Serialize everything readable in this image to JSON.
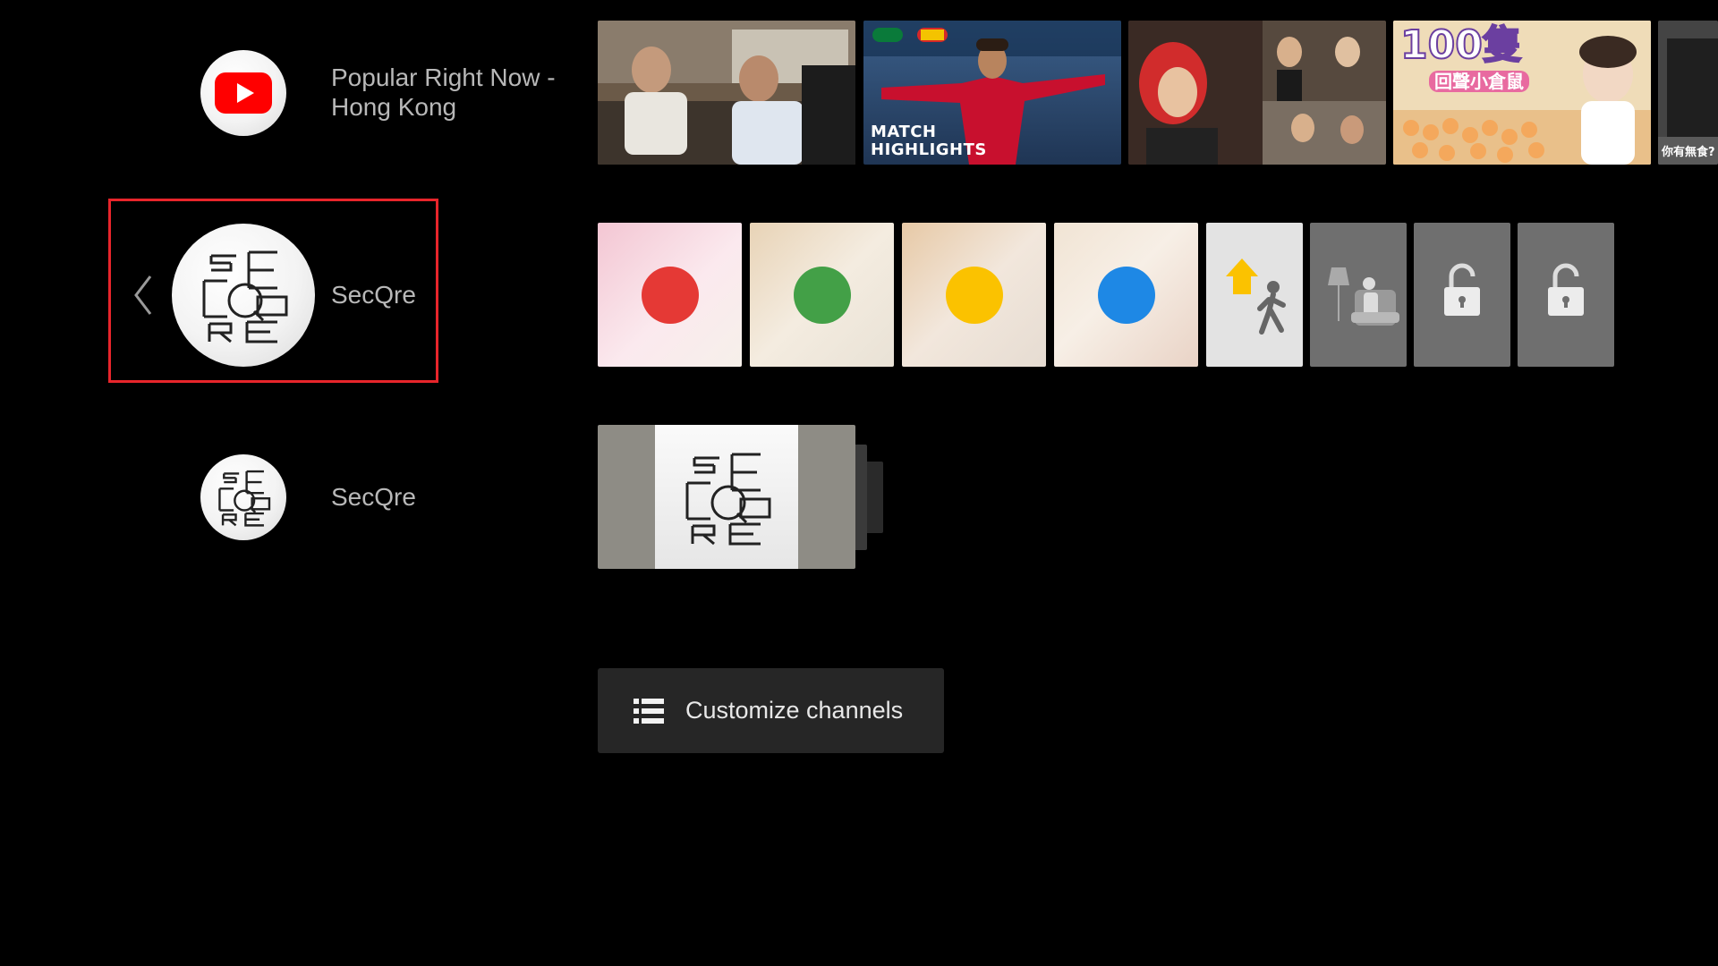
{
  "channels": [
    {
      "label_line1": "Popular Right Now -",
      "label_line2": "Hong Kong",
      "icon": "youtube-icon"
    },
    {
      "label": "SecQre",
      "icon": "secqre-logo",
      "focused": true
    },
    {
      "label": "SecQre",
      "icon": "secqre-logo"
    }
  ],
  "row1": {
    "items": [
      {
        "name": "video-thumbnail-interview"
      },
      {
        "name": "video-thumbnail-match-highlights",
        "overlay_line1": "MATCH",
        "overlay_line2": "HIGHLIGHTS"
      },
      {
        "name": "video-thumbnail-celebrities"
      },
      {
        "name": "video-thumbnail-hamsters",
        "overlay": "100隻",
        "overlay_sub": "回聲小倉鼠"
      },
      {
        "name": "video-thumbnail-partial",
        "overlay": "你有無食?"
      }
    ]
  },
  "row2": {
    "dots": [
      {
        "color": "#e53935",
        "name": "red-dot-tile"
      },
      {
        "color": "#43a047",
        "name": "green-dot-tile"
      },
      {
        "color": "#fbc200",
        "name": "yellow-dot-tile"
      },
      {
        "color": "#1e88e5",
        "name": "blue-dot-tile"
      }
    ],
    "icons": [
      "home-leave-icon",
      "home-sitting-icon",
      "unlock-icon",
      "unlock-icon"
    ]
  },
  "customize": {
    "label": "Customize channels",
    "icon": "list-icon"
  },
  "colors": {
    "focus": "#e8252b",
    "background": "#000000",
    "youtube_red": "#ff0000"
  }
}
